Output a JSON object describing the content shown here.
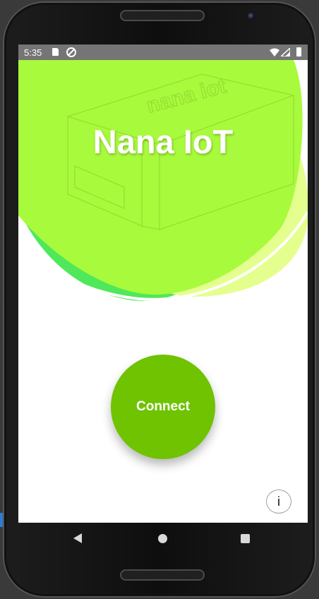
{
  "status_bar": {
    "time": "5:35",
    "icons": [
      "sd-card-icon",
      "data-saver-icon",
      "wifi-icon",
      "signal-icon",
      "battery-icon"
    ]
  },
  "hero": {
    "title": "Nana IoT",
    "device_label": "nana iot",
    "colors": {
      "primary": "#a8fa3c",
      "secondary": "#4fe85a",
      "light": "#e4ff8e"
    }
  },
  "main": {
    "connect_label": "Connect",
    "info_label": "i",
    "accent": "#6fc300"
  },
  "nav_bar": {
    "buttons": [
      "back-icon",
      "home-icon",
      "recents-icon"
    ]
  }
}
